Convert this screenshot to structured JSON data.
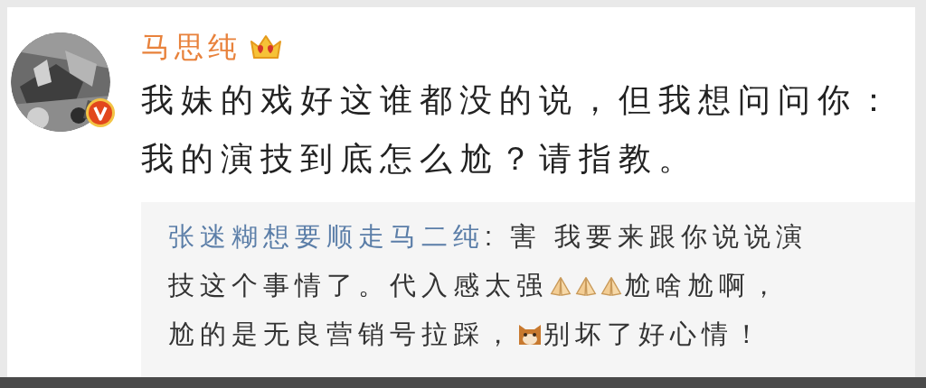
{
  "author": {
    "name": "马思纯",
    "verified": true
  },
  "post": {
    "lines": [
      "我妹的戏好这谁都没的说，但我想问问你：",
      "我的演技到底怎么尬？请指教。"
    ]
  },
  "reply": {
    "lines": [
      [
        {
          "kind": "user",
          "text": "张迷糊想要顺走马二纯"
        },
        {
          "kind": "text",
          "text": ": 害 我要来跟你说说演"
        }
      ],
      [
        {
          "kind": "text",
          "text": "技这个事情了。代入感太强"
        },
        {
          "kind": "hands"
        },
        {
          "kind": "hands"
        },
        {
          "kind": "hands"
        },
        {
          "kind": "text",
          "text": "尬啥尬啊，"
        }
      ],
      [
        {
          "kind": "text",
          "text": "尬的是无良营销号拉踩，"
        },
        {
          "kind": "cat"
        },
        {
          "kind": "text",
          "text": "别坏了好心情！"
        }
      ]
    ]
  }
}
